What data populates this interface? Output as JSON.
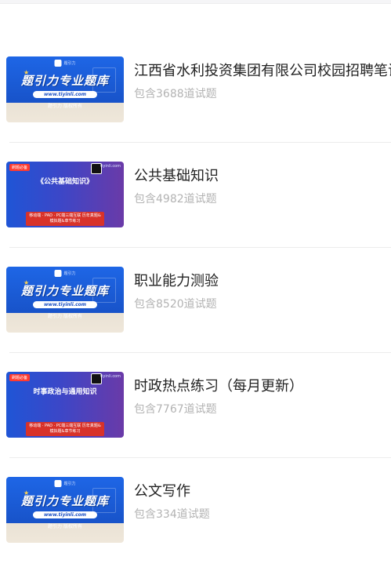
{
  "items": [
    {
      "title": "江西省水利投资集团有限公司校园招聘笔试",
      "subtitle": "包含3688道试题",
      "thumb": {
        "style": "blue",
        "logo_text": "题引力",
        "title": "题引力专业题库",
        "url": "www.tiyinli.com",
        "footer": "题引力 版权所有"
      }
    },
    {
      "title": "公共基础知识",
      "subtitle": "包含4982道试题",
      "thumb": {
        "style": "purple",
        "tag": "刷题必备",
        "corner": "tiyinli.com",
        "heading": "《公共基础知识》",
        "info": "移动端 · PAD · PC端三端互联 历年真题&模拟题&章节练习"
      }
    },
    {
      "title": "职业能力测验",
      "subtitle": "包含8520道试题",
      "thumb": {
        "style": "blue",
        "logo_text": "题引力",
        "title": "题引力专业题库",
        "url": "www.tiyinli.com",
        "footer": "题引力 版权所有"
      }
    },
    {
      "title": "时政热点练习（每月更新）",
      "subtitle": "包含7767道试题",
      "thumb": {
        "style": "purple",
        "tag": "刷题必备",
        "corner": "tiyinli.com",
        "heading": "时事政治与通用知识",
        "info": "移动端 · PAD · PC端三端互联 历年真题&模拟题&章节练习"
      }
    },
    {
      "title": "公文写作",
      "subtitle": "包含334道试题",
      "thumb": {
        "style": "blue",
        "logo_text": "题引力",
        "title": "题引力专业题库",
        "url": "www.tiyinli.com",
        "footer": "题引力 版权所有"
      }
    }
  ]
}
